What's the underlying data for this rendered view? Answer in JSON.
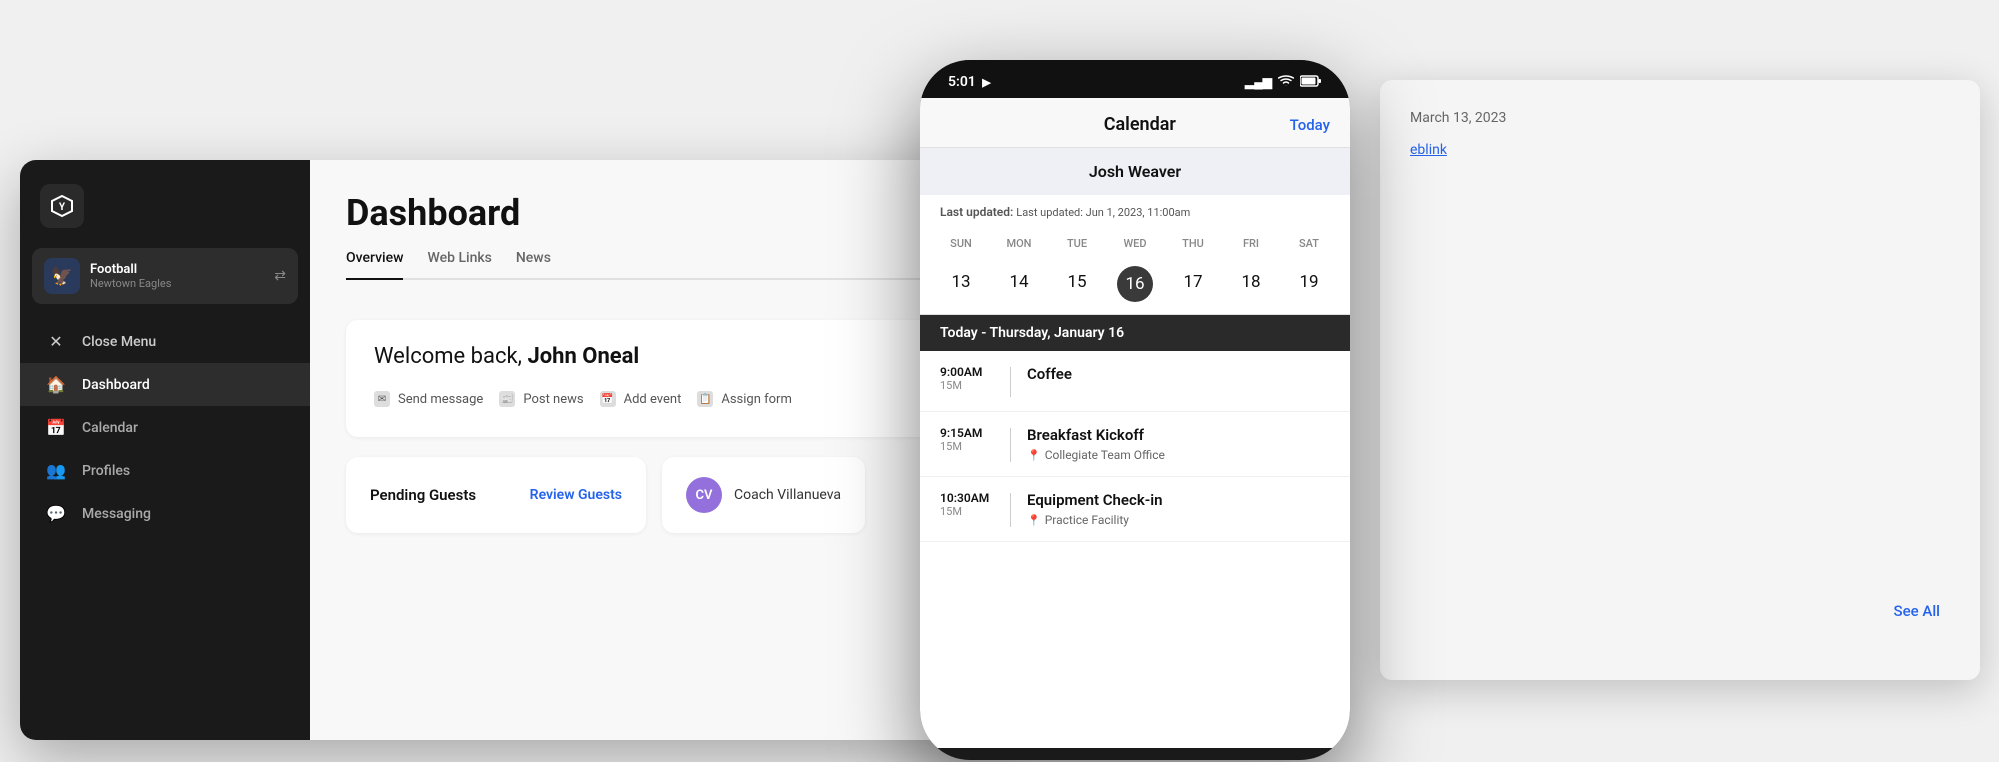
{
  "app": {
    "title": "Dashboard"
  },
  "background_window": {
    "date": "March 13, 2023",
    "link_text": "eblink",
    "see_all": "See All"
  },
  "sidebar": {
    "logo_text": "Y",
    "team": {
      "name": "Football",
      "sub": "Newtown Eagles",
      "icon_text": "🦅"
    },
    "close_menu_label": "Close Menu",
    "nav_items": [
      {
        "id": "dashboard",
        "label": "Dashboard",
        "icon": "🏠",
        "active": true
      },
      {
        "id": "calendar",
        "label": "Calendar",
        "icon": "📅",
        "active": false
      },
      {
        "id": "profiles",
        "label": "Profiles",
        "icon": "👥",
        "active": false
      },
      {
        "id": "messaging",
        "label": "Messaging",
        "icon": "💬",
        "active": false
      }
    ]
  },
  "main": {
    "page_title": "Dashboard",
    "tabs": [
      {
        "id": "overview",
        "label": "Overview",
        "active": true
      },
      {
        "id": "web-links",
        "label": "Web Links",
        "active": false
      },
      {
        "id": "news",
        "label": "News",
        "active": false
      }
    ],
    "welcome": {
      "prefix": "Welcome back, ",
      "name": "John Oneal"
    },
    "actions": [
      {
        "id": "send-message",
        "label": "Send message",
        "icon": "✉"
      },
      {
        "id": "post-news",
        "label": "Post news",
        "icon": "📰"
      },
      {
        "id": "add-event",
        "label": "Add event",
        "icon": "📅"
      },
      {
        "id": "assign-form",
        "label": "Assign form",
        "icon": "📋"
      }
    ],
    "pending_guests": {
      "label": "Pending Guests",
      "action_label": "Review Guests"
    },
    "coach": {
      "name": "Coach Villanueva",
      "initials": "CV"
    }
  },
  "phone": {
    "status_bar": {
      "time": "5:01",
      "location_icon": "▶",
      "signal": "▂▄",
      "wifi": "wifi",
      "battery": "🔋"
    },
    "header": {
      "title": "Calendar",
      "today_btn": "Today"
    },
    "calendar_user": "Josh Weaver",
    "last_updated": "Last updated: Jun 1, 2023, 11:00am",
    "week": {
      "days": [
        "SUN",
        "MON",
        "TUE",
        "WED",
        "THU",
        "FRI",
        "SAT"
      ],
      "dates": [
        "13",
        "14",
        "15",
        "16",
        "17",
        "18",
        "19"
      ],
      "today_index": 3
    },
    "today_label": "Today - Thursday, January 16",
    "events": [
      {
        "time": "9:00AM",
        "duration": "15M",
        "title": "Coffee",
        "location": null
      },
      {
        "time": "9:15AM",
        "duration": "15M",
        "title": "Breakfast Kickoff",
        "location": "Collegiate Team Office"
      },
      {
        "time": "10:30AM",
        "duration": "15M",
        "title": "Equipment Check-in",
        "location": "Practice Facility"
      }
    ]
  }
}
